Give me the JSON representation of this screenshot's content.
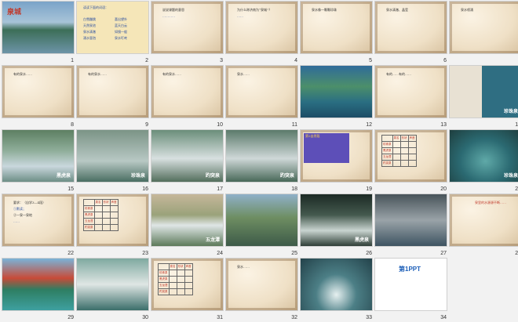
{
  "slides": [
    {
      "n": "1",
      "title": "泉城"
    },
    {
      "n": "2",
      "lines": [
        "读读下面的词语：",
        "白雪蹦跳",
        "喜出望外",
        "天然泉池",
        "蓝天白云",
        "泉水清澈",
        "如镜一般",
        "涌水冒泡",
        "泉水叮咚"
      ]
    },
    {
      "n": "3",
      "lines": [
        "说说课题的意思",
        "…………"
      ]
    },
    {
      "n": "4",
      "lines": [
        "为什么称济南为“泉城”？",
        "……"
      ]
    },
    {
      "n": "5",
      "lines": [
        "泉水像一颗颗珍珠"
      ]
    },
    {
      "n": "6",
      "lines": [
        "泉水清澈、晶莹"
      ]
    },
    {
      "n": "7",
      "lines": [
        "泉水喷涌"
      ]
    },
    {
      "n": "8",
      "lines": [
        "有的泉水……"
      ]
    },
    {
      "n": "9",
      "lines": [
        "有的泉水……"
      ]
    },
    {
      "n": "10",
      "lines": [
        "有的泉水……"
      ]
    },
    {
      "n": "11",
      "lines": [
        "泉水……"
      ]
    },
    {
      "n": "12",
      "lines": [
        ""
      ]
    },
    {
      "n": "13",
      "lines": [
        "有的……有的……"
      ]
    },
    {
      "n": "14",
      "label": "珍珠泉"
    },
    {
      "n": "15",
      "label": "黑虎泉"
    },
    {
      "n": "16",
      "label": "珍珠泉"
    },
    {
      "n": "17",
      "label": "趵突泉"
    },
    {
      "n": "18",
      "label": "趵突泉"
    },
    {
      "n": "19",
      "lines": [
        "第2自然段"
      ]
    },
    {
      "n": "20",
      "headers": [
        "泉名",
        "形状",
        "声音"
      ],
      "rows": [
        "珍珠泉",
        "黑虎泉",
        "五龙潭",
        "趵突泉"
      ]
    },
    {
      "n": "21",
      "label": "珍珠泉"
    },
    {
      "n": "22",
      "lines": [
        "要求：（自学3—4段）",
        "①默读；",
        "②一泉一泉地",
        "……"
      ]
    },
    {
      "n": "23",
      "headers": [
        "泉名",
        "形状",
        "声音"
      ],
      "rows": [
        "珍珠泉",
        "黑虎泉",
        "五龙潭",
        "趵突泉"
      ]
    },
    {
      "n": "24",
      "label": "五龙潭"
    },
    {
      "n": "25",
      "label": ""
    },
    {
      "n": "26",
      "label": "黑虎泉"
    },
    {
      "n": "27",
      "label": ""
    },
    {
      "n": "28",
      "lines": [
        "泉里的水源源不断……"
      ]
    },
    {
      "n": "29",
      "label": ""
    },
    {
      "n": "30",
      "label": ""
    },
    {
      "n": "31",
      "headers": [
        "泉名",
        "形状",
        "声音"
      ],
      "rows": [
        "珍珠泉",
        "黑虎泉",
        "五龙潭",
        "趵突泉"
      ]
    },
    {
      "n": "32",
      "lines": [
        "泉水……"
      ]
    },
    {
      "n": "33",
      "label": ""
    },
    {
      "n": "34",
      "logo": "第1PPT"
    }
  ]
}
